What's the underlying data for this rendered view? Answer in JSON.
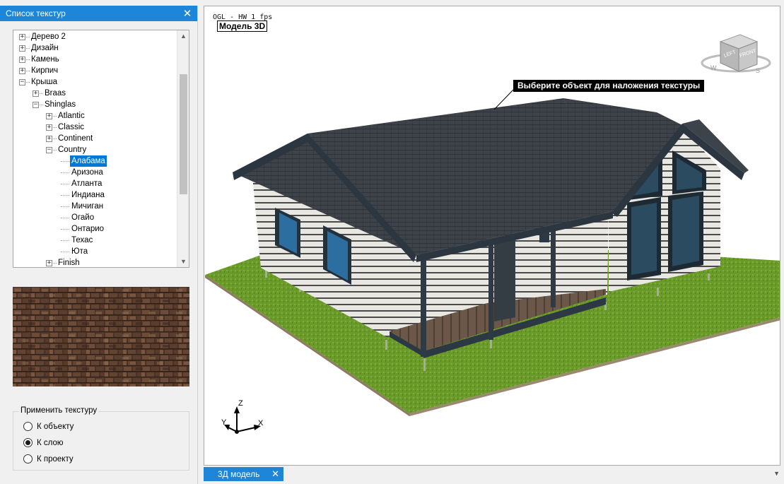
{
  "panel": {
    "title": "Список текстур",
    "close_icon": "close-icon"
  },
  "tree": {
    "rows": [
      {
        "label": "Дерево 2",
        "level": 0,
        "expander": "+"
      },
      {
        "label": "Дизайн",
        "level": 0,
        "expander": "+"
      },
      {
        "label": "Камень",
        "level": 0,
        "expander": "+"
      },
      {
        "label": "Кирпич",
        "level": 0,
        "expander": "+"
      },
      {
        "label": "Крыша",
        "level": 0,
        "expander": "-"
      },
      {
        "label": "Braas",
        "level": 1,
        "expander": "+"
      },
      {
        "label": "Shinglas",
        "level": 1,
        "expander": "-"
      },
      {
        "label": "Atlantic",
        "level": 2,
        "expander": "+"
      },
      {
        "label": "Classic",
        "level": 2,
        "expander": "+"
      },
      {
        "label": "Continent",
        "level": 2,
        "expander": "+"
      },
      {
        "label": "Country",
        "level": 2,
        "expander": "-"
      },
      {
        "label": "Алабама",
        "level": 3,
        "expander": "",
        "selected": true
      },
      {
        "label": "Аризона",
        "level": 3,
        "expander": ""
      },
      {
        "label": "Атланта",
        "level": 3,
        "expander": ""
      },
      {
        "label": "Индиана",
        "level": 3,
        "expander": ""
      },
      {
        "label": "Мичиган",
        "level": 3,
        "expander": ""
      },
      {
        "label": "Огайо",
        "level": 3,
        "expander": ""
      },
      {
        "label": "Онтарио",
        "level": 3,
        "expander": ""
      },
      {
        "label": "Техас",
        "level": 3,
        "expander": ""
      },
      {
        "label": "Юта",
        "level": 3,
        "expander": ""
      },
      {
        "label": "Finish",
        "level": 2,
        "expander": "+"
      }
    ],
    "scroll_up_icon": "chevron-up-icon",
    "scroll_down_icon": "chevron-down-icon"
  },
  "apply_texture": {
    "legend": "Применить текстуру",
    "options": [
      {
        "label": "К объекту",
        "checked": false
      },
      {
        "label": "К слою",
        "checked": true
      },
      {
        "label": "К проекту",
        "checked": false
      }
    ]
  },
  "viewport": {
    "info": "OGL - HW 1 fps",
    "mode": "Модель 3D",
    "prompt": "Выберите объект для наложения текстуры",
    "viewcube": {
      "left": "LEFT",
      "front": "FRONT",
      "west": "W",
      "south": "S"
    },
    "axes": {
      "x": "X",
      "y": "Y",
      "z": "Z"
    }
  },
  "tabs": {
    "active": "3Д модель",
    "close_icon": "close-icon",
    "menu_icon": "chevron-down-icon"
  },
  "colors": {
    "accent": "#1e86d8",
    "selection": "#0078d7",
    "roof": "#3b4046",
    "siding": "#e6e4df",
    "trim": "#2f3c48",
    "grass": "#6c9a2c"
  }
}
